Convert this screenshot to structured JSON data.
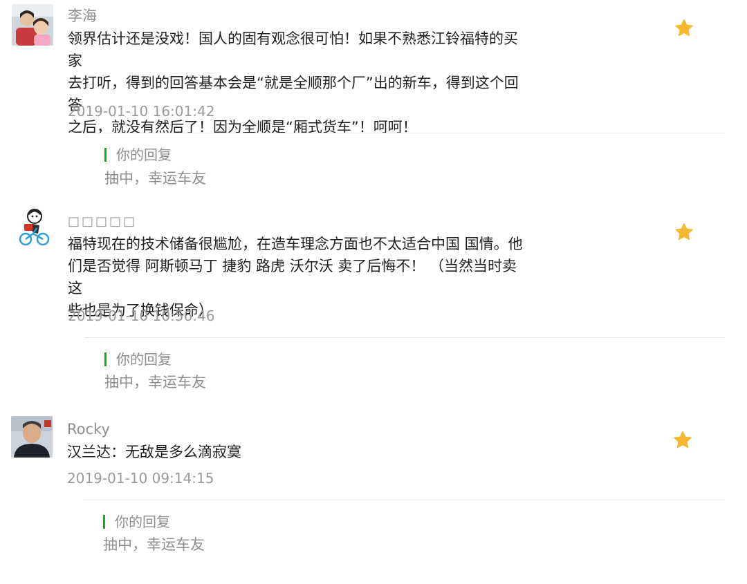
{
  "comments": [
    {
      "nickname": "李海",
      "avatar": "photo-parent-and-child",
      "lines": [
        "领界估计还是没戏！国人的固有观念很可怕！如果不熟悉江铃福特的买家",
        "去打听，得到的回答基本会是“就是全顺那个厂”出的新车，得到这个回答",
        "之后，就没有然后了！因为全顺是“厢式货车”！呵呵！"
      ],
      "timestamp": "2019-01-10 16:01:42",
      "icon": "star-icon",
      "reply_label": "你的回复",
      "reply_text": "抽中，幸运车友"
    },
    {
      "nickname": "□□□□□",
      "avatar": "cartoon-cyclist",
      "lines": [
        "福特现在的技术储备很尴尬，在造车理念方面也不太适合中国 国情。他",
        "们是否觉得 阿斯顿马丁 捷豹 路虎 沃尔沃 卖了后悔不！  （当然当时卖这",
        "些也是为了换钱保命）"
      ],
      "timestamp": "2019-01-10 10:56:46",
      "icon": "star-icon",
      "reply_label": "你的回复",
      "reply_text": "抽中，幸运车友"
    },
    {
      "nickname": "Rocky",
      "avatar": "photo-man",
      "lines": [
        "汉兰达：无敌是多么滴寂寞"
      ],
      "timestamp": "2019-01-10 09:14:15",
      "icon": "star-icon",
      "reply_label": "你的回复",
      "reply_text": "抽中，幸运车友"
    }
  ],
  "colors": {
    "star": "#f5b82e",
    "reply_bar": "#1aad19",
    "muted_text": "#8e8e8e",
    "divider": "#e6e6e6"
  }
}
